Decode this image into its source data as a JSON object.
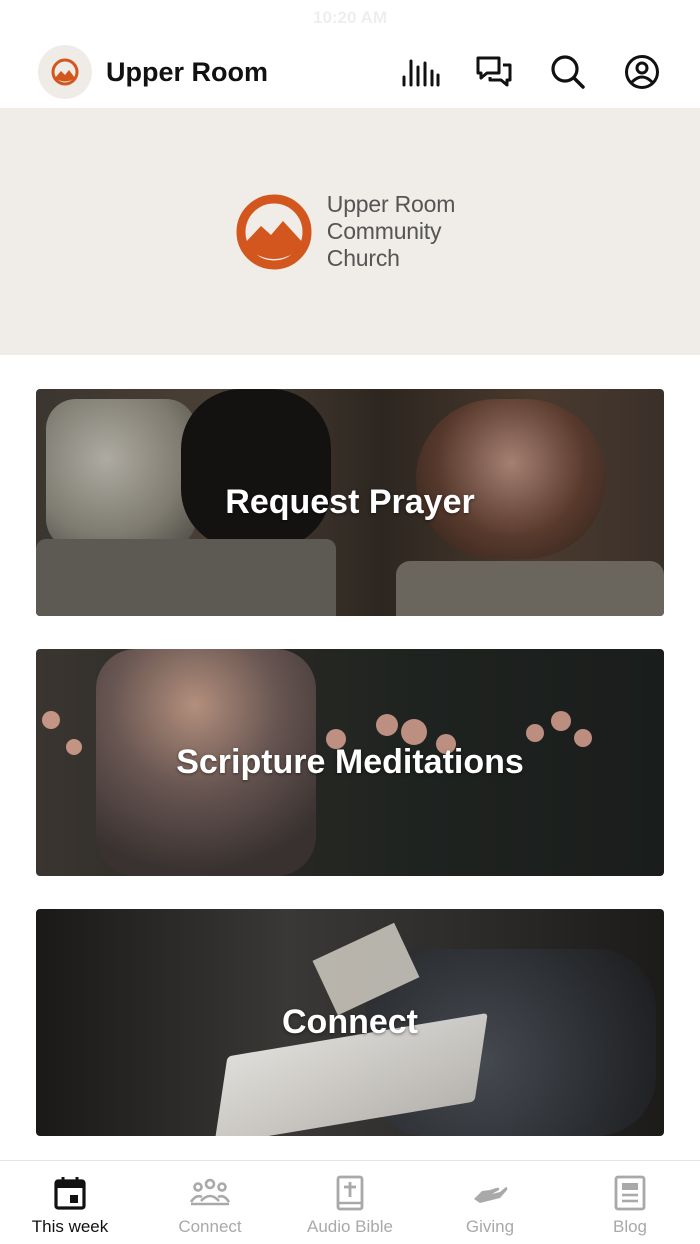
{
  "status_bar": {
    "time": "10:20 AM"
  },
  "header": {
    "title": "Upper Room",
    "actions": [
      {
        "label": "Audio",
        "icon": "audio-bars-icon"
      },
      {
        "label": "Messages",
        "icon": "chat-icon"
      },
      {
        "label": "Search",
        "icon": "search-icon"
      },
      {
        "label": "Profile",
        "icon": "user-icon"
      }
    ]
  },
  "banner": {
    "brand_lines": [
      "Upper Room",
      "Community",
      "Church"
    ],
    "brand_color": "#d2561d"
  },
  "cards": [
    {
      "title": "Request Prayer"
    },
    {
      "title": "Scripture Meditations"
    },
    {
      "title": "Connect"
    }
  ],
  "tabs": [
    {
      "label": "This week",
      "icon": "calendar-icon",
      "active": true
    },
    {
      "label": "Connect",
      "icon": "people-icon",
      "active": false
    },
    {
      "label": "Audio Bible",
      "icon": "bible-icon",
      "active": false
    },
    {
      "label": "Giving",
      "icon": "giving-hand-icon",
      "active": false
    },
    {
      "label": "Blog",
      "icon": "blog-icon",
      "active": false
    }
  ],
  "colors": {
    "accent": "#d2561d",
    "banner_bg": "#f0ede8",
    "inactive_tab": "#a9a9a9"
  }
}
